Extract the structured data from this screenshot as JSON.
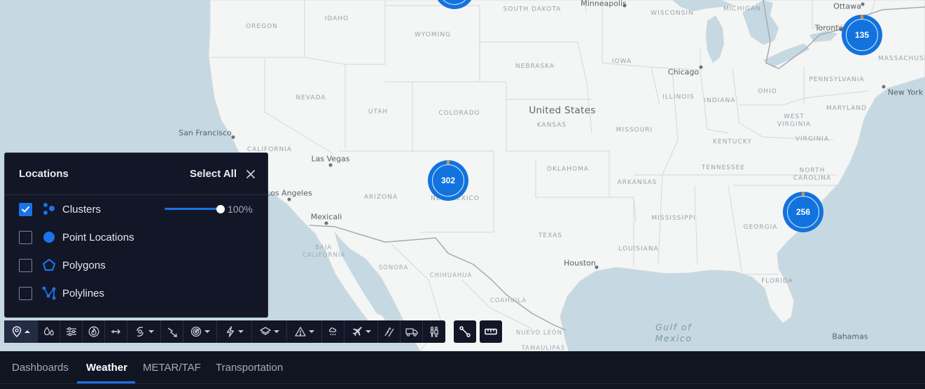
{
  "map": {
    "country_label": "United States",
    "water_label": "Gulf of Mexico",
    "state_labels": [
      "OREGON",
      "IDAHO",
      "WYOMING",
      "SOUTH DAKOTA",
      "NEBRASKA",
      "IOWA",
      "WISCONSIN",
      "MICHIGAN",
      "PENNSYLVANIA",
      "NEVADA",
      "UTAH",
      "COLORADO",
      "KANSAS",
      "MISSOURI",
      "ILLINOIS",
      "INDIANA",
      "OHIO",
      "WEST VIRGINIA",
      "MARYLAND",
      "VIRGINIA",
      "KENTUCKY",
      "CALIFORNIA",
      "OKLAHOMA",
      "ARKANSAS",
      "TENNESSEE",
      "NORTH CAROLINA",
      "ARIZONA",
      "NEW MEXICO",
      "MISSISSIPPI",
      "TEXAS",
      "LOUISIANA",
      "GEORGIA",
      "FLORIDA",
      "BAJA CALIFORNIA",
      "SONORA",
      "CHIHUAHUA",
      "COAHUILA",
      "NUEVO LEÓN",
      "TAMAULIPAS",
      "MASSACHUSETTS"
    ],
    "cities": [
      "Minneapolis",
      "Ottawa",
      "Toronto",
      "Chicago",
      "New York",
      "San Francisco",
      "Las Vegas",
      "Los Angeles",
      "Mexicali",
      "Houston",
      "Bahamas"
    ],
    "clusters": [
      {
        "id": "ny",
        "count": "135"
      },
      {
        "id": "nm",
        "count": "302"
      },
      {
        "id": "sc",
        "count": "256"
      }
    ]
  },
  "locations_panel": {
    "title": "Locations",
    "select_all": "Select All",
    "close_icon": "close-icon",
    "opacity_label": "100%",
    "opacity_value": 1.0,
    "items": [
      {
        "label": "Clusters",
        "checked": true,
        "icon": "clusters-icon"
      },
      {
        "label": "Point Locations",
        "checked": false,
        "icon": "point-icon"
      },
      {
        "label": "Polygons",
        "checked": false,
        "icon": "polygon-icon"
      },
      {
        "label": "Polylines",
        "checked": false,
        "icon": "polyline-icon"
      }
    ]
  },
  "toolbar": {
    "tools": [
      "location-pin-icon",
      "water-drops-icon",
      "wind-sliders-icon",
      "wildfire-icon",
      "arrows-icon",
      "hurricane-icon",
      "lightning-strike-icon",
      "radar-icon",
      "lightning-icon",
      "layers-icon",
      "warning-icon",
      "weather-alert-icon",
      "airplane-icon",
      "road-icon",
      "truck-icon",
      "people-icon",
      "route-icon",
      "ruler-icon"
    ]
  },
  "tabs": {
    "items": [
      "Dashboards",
      "Weather",
      "METAR/TAF",
      "Transportation"
    ],
    "active": "Weather"
  },
  "colors": {
    "accent": "#1a73e8",
    "cluster": "#1273de",
    "panel_bg": "#121626",
    "land": "#f4f5f5",
    "water": "#c6d8e1"
  }
}
